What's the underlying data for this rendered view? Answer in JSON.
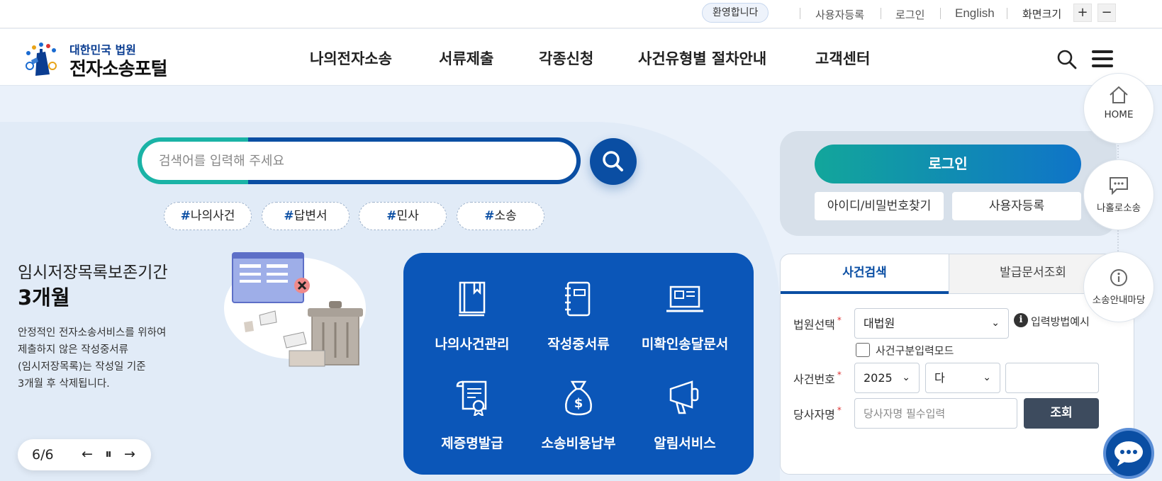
{
  "util_bar": {
    "welcome": "환영합니다",
    "register": "사용자등록",
    "login": "로그인",
    "english": "English",
    "zoom_label": "화면크기",
    "zoom_in": "+",
    "zoom_out": "−"
  },
  "logo": {
    "sub": "대한민국 법원",
    "main": "전자소송포털"
  },
  "nav": {
    "items": [
      "나의전자소송",
      "서류제출",
      "각종신청",
      "사건유형별 절차안내",
      "고객센터"
    ],
    "search_icon": "search-icon",
    "menu_icon": "hamburger-icon"
  },
  "search": {
    "placeholder": "검색어를 입력해 주세요",
    "tags": [
      {
        "hash": "#",
        "label": "나의사건"
      },
      {
        "hash": "#",
        "label": "답변서"
      },
      {
        "hash": "#",
        "label": "민사"
      },
      {
        "hash": "#",
        "label": "소송"
      }
    ]
  },
  "notice": {
    "title_line1": "임시저장목록보존기간",
    "title_line2": "3개월",
    "body_lines": [
      "안정적인 전자소송서비스를 위하여",
      "제출하지 않은 작성중서류",
      "(임시저장목록)는 작성일 기준",
      "3개월 후 삭제됩니다."
    ]
  },
  "pager": {
    "count": "6/6",
    "prev": "←",
    "pause": "⏸",
    "next": "→"
  },
  "quick_menu": {
    "items": [
      {
        "label": "나의사건관리",
        "icon": "book-icon"
      },
      {
        "label": "작성중서류",
        "icon": "notebook-icon"
      },
      {
        "label": "미확인송달문서",
        "icon": "laptop-icon"
      },
      {
        "label": "제증명발급",
        "icon": "certificate-icon"
      },
      {
        "label": "소송비용납부",
        "icon": "money-bag-icon"
      },
      {
        "label": "알림서비스",
        "icon": "megaphone-icon"
      }
    ]
  },
  "login": {
    "button": "로그인",
    "find_id": "아이디/비밀번호찾기",
    "register": "사용자등록"
  },
  "case_search": {
    "tabs": [
      "사건검색",
      "발급문서조회"
    ],
    "court_label": "법원선택",
    "court_value": "대법원",
    "input_example": "입력방법예시",
    "case_mode_label": "사건구분입력모드",
    "case_no_label": "사건번호",
    "year_value": "2025",
    "type_value": "다",
    "party_label": "당사자명",
    "party_placeholder": "당사자명 필수입력",
    "search_button": "조회",
    "required_mark": "*"
  },
  "float_nav": {
    "home": "HOME",
    "my_case": "나홀로소송",
    "guide": "소송안내마당"
  },
  "colors": {
    "primary": "#0a4ea3",
    "teal": "#12a69b",
    "quick_bg": "#0b56b8",
    "dark_button": "#3d4b5e"
  }
}
